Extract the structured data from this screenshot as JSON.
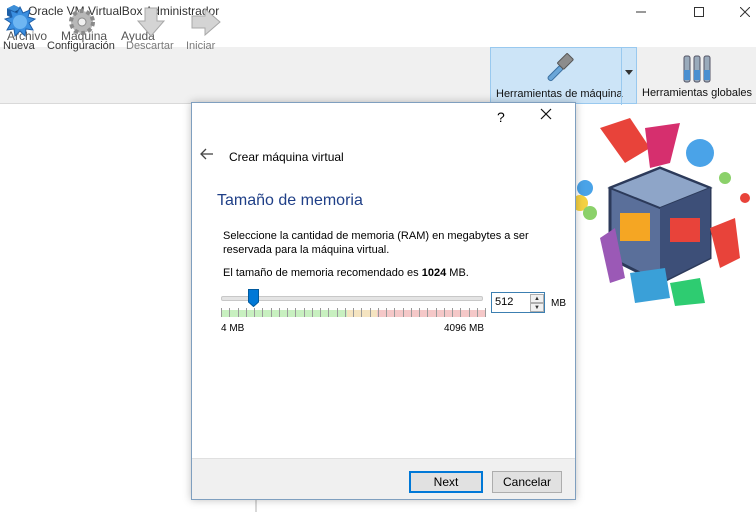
{
  "window": {
    "title": "Oracle VM VirtualBox Administrador"
  },
  "menu": [
    "Archivo",
    "Máquina",
    "Ayuda"
  ],
  "toolbar": {
    "new_label": "Nueva",
    "settings_label": "Configuración",
    "discard_label": "Descartar",
    "start_label": "Iniciar",
    "machine_tools_label": "Herramientas de máquina",
    "global_tools_label": "Herramientas globales"
  },
  "dialog": {
    "help_label": "?",
    "header": "Crear máquina virtual",
    "section_title": "Tamaño de memoria",
    "description": "Seleccione la cantidad de memoria (RAM) en megabytes a ser reservada para la máquina virtual.",
    "recommend_prefix": "El tamaño de memoria recomendado es",
    "recommend_value": "1024",
    "recommend_suffix": "MB.",
    "memory_value": "512",
    "memory_unit": "MB",
    "slider_min_label": "4 MB",
    "slider_max_label": "4096 MB",
    "slider_fraction": 0.125,
    "next_label": "Next",
    "cancel_label": "Cancelar"
  },
  "colors": {
    "accent": "#0078d7",
    "section_title": "#1f3f87",
    "tools_active_bg": "#cce4f7"
  }
}
